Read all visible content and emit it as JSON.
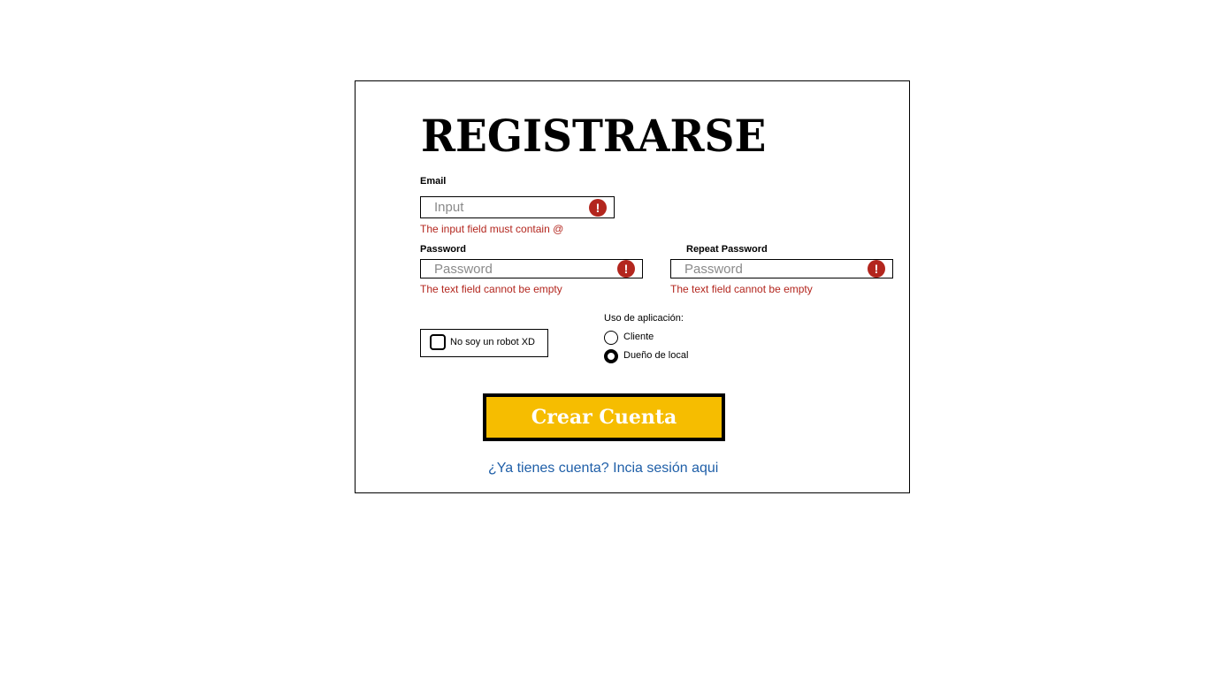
{
  "form": {
    "title": "REGISTRARSE",
    "email": {
      "label": "Email",
      "placeholder": "Input",
      "error": "The input field must contain @",
      "error_icon": "exclamation-icon"
    },
    "password": {
      "label": "Password",
      "placeholder": "Password",
      "error": "The text field cannot be empty",
      "error_icon": "exclamation-icon"
    },
    "repeat_password": {
      "label": "Repeat Password",
      "placeholder": "Password",
      "error": "The text field cannot be empty",
      "error_icon": "exclamation-icon"
    },
    "captcha": {
      "label": "No soy un robot XD",
      "checked": false
    },
    "usage": {
      "label": "Uso de aplicación:",
      "options": [
        {
          "label": "Cliente",
          "selected": false
        },
        {
          "label": "Dueño de local",
          "selected": true
        }
      ]
    },
    "submit_label": "Crear Cuenta",
    "login_link": "¿Ya tienes cuenta? Incia sesión aqui"
  },
  "colors": {
    "accent": "#f6bd00",
    "error": "#b3261e",
    "link": "#1f5fa8"
  }
}
